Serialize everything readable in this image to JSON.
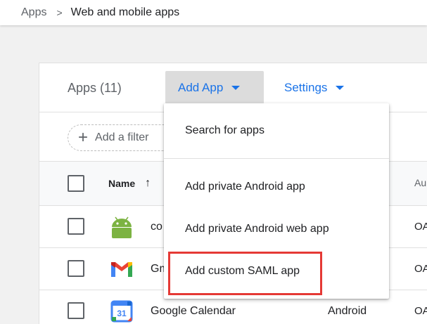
{
  "breadcrumb": {
    "root": "Apps",
    "separator": ">",
    "current": "Web and mobile apps"
  },
  "header": {
    "apps_count": "Apps (11)",
    "add_app_label": "Add App",
    "settings_label": "Settings"
  },
  "filter": {
    "label": "Add a filter"
  },
  "table": {
    "columns": {
      "name": "Name",
      "sort_indicator": "↑",
      "auth_partial": "Au"
    },
    "rows": [
      {
        "name": "co",
        "type": "",
        "auth": "OA",
        "icon": "android-icon"
      },
      {
        "name": "Gm",
        "type": "",
        "auth": "OA",
        "icon": "gmail-icon"
      },
      {
        "name": "Google Calendar",
        "type": "Android",
        "auth": "OA",
        "icon": "google-calendar-icon"
      }
    ]
  },
  "menu": {
    "items": [
      "Search for apps",
      "Add private Android app",
      "Add private Android web app",
      "Add custom SAML app"
    ],
    "highlighted": "Add custom SAML app",
    "highlight_color": "#e53935"
  },
  "colors": {
    "accent": "#1a73e8",
    "add_app_bg": "#dcdcdc",
    "page_bg": "#f1f1f1"
  }
}
